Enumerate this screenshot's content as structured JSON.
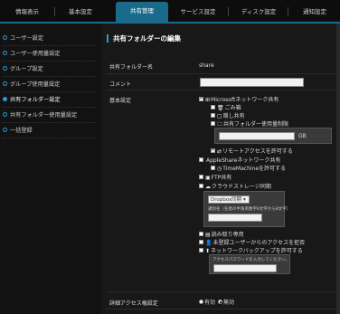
{
  "nav": {
    "tabs": [
      {
        "label": "情報表示"
      },
      {
        "label": "基本設定"
      },
      {
        "label": "共有管理"
      },
      {
        "label": "サービス設定"
      },
      {
        "label": "ディスク設定"
      },
      {
        "label": "通知設定"
      }
    ],
    "active": "共有管理"
  },
  "sidebar": {
    "items": [
      {
        "label": "ユーザー設定"
      },
      {
        "label": "ユーザー使用量設定"
      },
      {
        "label": "グループ設定"
      },
      {
        "label": "グループ使用量設定"
      },
      {
        "label": "共有フォルダー設定"
      },
      {
        "label": "共有フォルダー使用量設定"
      },
      {
        "label": "一括登録"
      }
    ],
    "active": "共有フォルダー設定"
  },
  "main": {
    "title": "共有フォルダーの編集",
    "name_label": "共有フォルダー名",
    "name_value": "share",
    "comment_label": "コメント",
    "comment_value": "",
    "basic_label": "基本設定",
    "ms_share": "Microsoftネットワーク共有",
    "recycle": "ごみ箱",
    "hidden_share": "隠し共有",
    "quota_limit": "共有フォルダー使用量制限",
    "quota_value": "",
    "quota_unit": "GB",
    "remote_access": "リモートアクセスを許可する",
    "appleshare": "AppleShareネットワーク共有",
    "timemachine": "TimeMachineを許可する",
    "ftp": "FTP共有",
    "cloud_sync": "クラウドストレージ同期",
    "cloud_select": "Dropbox同期",
    "cloud_hint": "識別名（任意の半角英数字8文字から8文字）",
    "read_only": "読み取り専用",
    "unregistered": "未登録ユーザーからのアクセスを拒否",
    "net_backup": "ネットワークバックアップを許可する",
    "backup_hint": "アクセスパスワードを入力してください。",
    "detail_label": "詳細アクセス権設定",
    "opt_enable": "有効",
    "opt_disable": "無効",
    "detail_selected": "無効"
  },
  "colors": {
    "accent": "#1a6a8c",
    "bullet": "#2a9ad4"
  }
}
